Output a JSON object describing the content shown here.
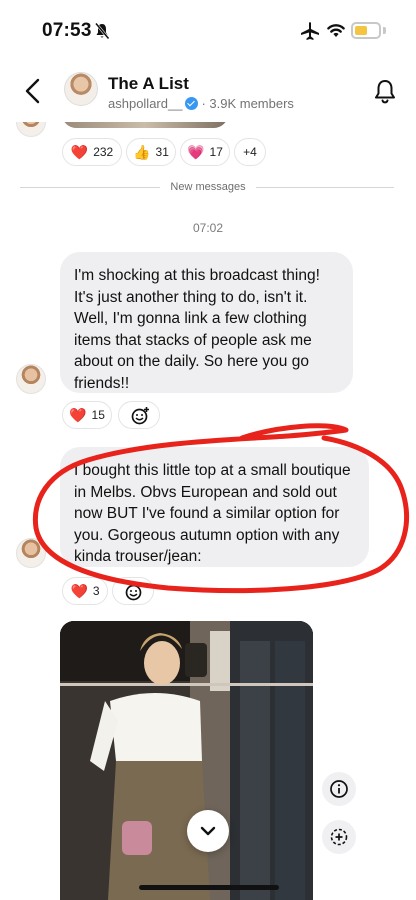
{
  "status_bar": {
    "time": "07:53",
    "battery_level": 0.55
  },
  "header": {
    "title": "The A List",
    "owner": "ashpollard__",
    "member_count": "· 3.9K members"
  },
  "prev_reactions": [
    {
      "emoji": "❤️",
      "count": "232"
    },
    {
      "emoji": "👍",
      "count": "31"
    },
    {
      "emoji": "💗",
      "count": "17"
    },
    {
      "emoji": "",
      "count": "+4"
    }
  ],
  "divider_label": "New messages",
  "timestamp": "07:02",
  "messages": [
    {
      "text": "I'm shocking at this broadcast thing! It's just another thing to do, isn't it. Well, I'm gonna link a few clothing items that stacks of people ask me about on the daily. So here you go friends!!",
      "reaction": {
        "emoji": "❤️",
        "count": "15"
      }
    },
    {
      "text": "I bought this little top at a small boutique in Melbs. Obvs European and sold out now BUT I've found a similar option for you. Gorgeous autumn option with any kinda trouser/jean:",
      "reaction": {
        "emoji": "❤️",
        "count": "3"
      }
    }
  ],
  "colors": {
    "annotation": "#e8231b",
    "bubble": "#efeff1",
    "verified": "#3897f0"
  }
}
